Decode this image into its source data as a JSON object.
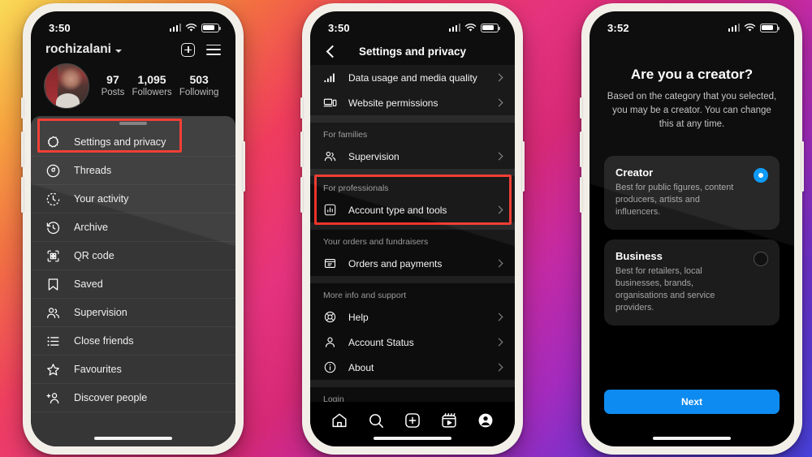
{
  "phone1": {
    "status": {
      "time": "3:50",
      "signal_icon": "signal-bars-icon",
      "wifi_icon": "wifi-icon",
      "battery_icon": "battery-icon"
    },
    "header": {
      "username": "rochizalani",
      "chevron_icon": "chevron-down-icon",
      "add_icon": "plus-square-icon",
      "menu_icon": "hamburger-menu-icon"
    },
    "profile": {
      "avatar_name": "profile-avatar",
      "stats": [
        {
          "num": "97",
          "label": "Posts"
        },
        {
          "num": "1,095",
          "label": "Followers"
        },
        {
          "num": "503",
          "label": "Following"
        }
      ]
    },
    "menu": [
      {
        "label": "Settings and privacy",
        "icon": "gear-icon",
        "highlighted": true
      },
      {
        "label": "Threads",
        "icon": "threads-icon",
        "highlighted": false
      },
      {
        "label": "Your activity",
        "icon": "activity-clock-icon",
        "highlighted": false
      },
      {
        "label": "Archive",
        "icon": "archive-clock-icon",
        "highlighted": false
      },
      {
        "label": "QR code",
        "icon": "qr-code-icon",
        "highlighted": false
      },
      {
        "label": "Saved",
        "icon": "bookmark-icon",
        "highlighted": false
      },
      {
        "label": "Supervision",
        "icon": "supervision-people-icon",
        "highlighted": false
      },
      {
        "label": "Close friends",
        "icon": "close-friends-list-icon",
        "highlighted": false
      },
      {
        "label": "Favourites",
        "icon": "star-icon",
        "highlighted": false
      },
      {
        "label": "Discover people",
        "icon": "discover-people-icon",
        "highlighted": false
      }
    ]
  },
  "phone2": {
    "status": {
      "time": "3:50"
    },
    "nav": {
      "back_icon": "back-chevron-icon",
      "title": "Settings and privacy"
    },
    "sections": [
      {
        "label": "",
        "rows": [
          {
            "label": "Data usage and media quality",
            "icon": "signal-bars-icon"
          },
          {
            "label": "Website permissions",
            "icon": "website-permissions-icon"
          }
        ]
      },
      {
        "label": "For families",
        "rows": [
          {
            "label": "Supervision",
            "icon": "supervision-people-icon"
          }
        ]
      },
      {
        "label": "For professionals",
        "highlighted": true,
        "rows": [
          {
            "label": "Account type and tools",
            "icon": "account-tools-chart-icon"
          }
        ]
      },
      {
        "label": "Your orders and fundraisers",
        "rows": [
          {
            "label": "Orders and payments",
            "icon": "orders-payments-icon"
          }
        ]
      },
      {
        "label": "More info and support",
        "rows": [
          {
            "label": "Help",
            "icon": "help-lifebuoy-icon"
          },
          {
            "label": "Account Status",
            "icon": "person-icon"
          },
          {
            "label": "About",
            "icon": "info-circle-icon"
          }
        ]
      }
    ],
    "cutoff_label": "Login",
    "tabbar": [
      {
        "name": "home-icon"
      },
      {
        "name": "search-icon"
      },
      {
        "name": "create-plus-icon"
      },
      {
        "name": "reels-icon"
      },
      {
        "name": "profile-icon"
      }
    ]
  },
  "phone3": {
    "status": {
      "time": "3:52"
    },
    "title": "Are you a creator?",
    "subtitle": "Based on the category that you selected, you may be a creator. You can change this at any time.",
    "options": [
      {
        "title": "Creator",
        "desc": "Best for public figures, content producers, artists and influencers.",
        "selected": true
      },
      {
        "title": "Business",
        "desc": "Best for retailers, local businesses, brands, organisations and service providers.",
        "selected": false
      }
    ],
    "next_label": "Next"
  },
  "colors": {
    "accent_blue": "#0095f6",
    "button_blue": "#0e8bf0",
    "highlight_red": "#f0342a",
    "sheet_grey": "#363636",
    "screen_black": "#000000"
  }
}
